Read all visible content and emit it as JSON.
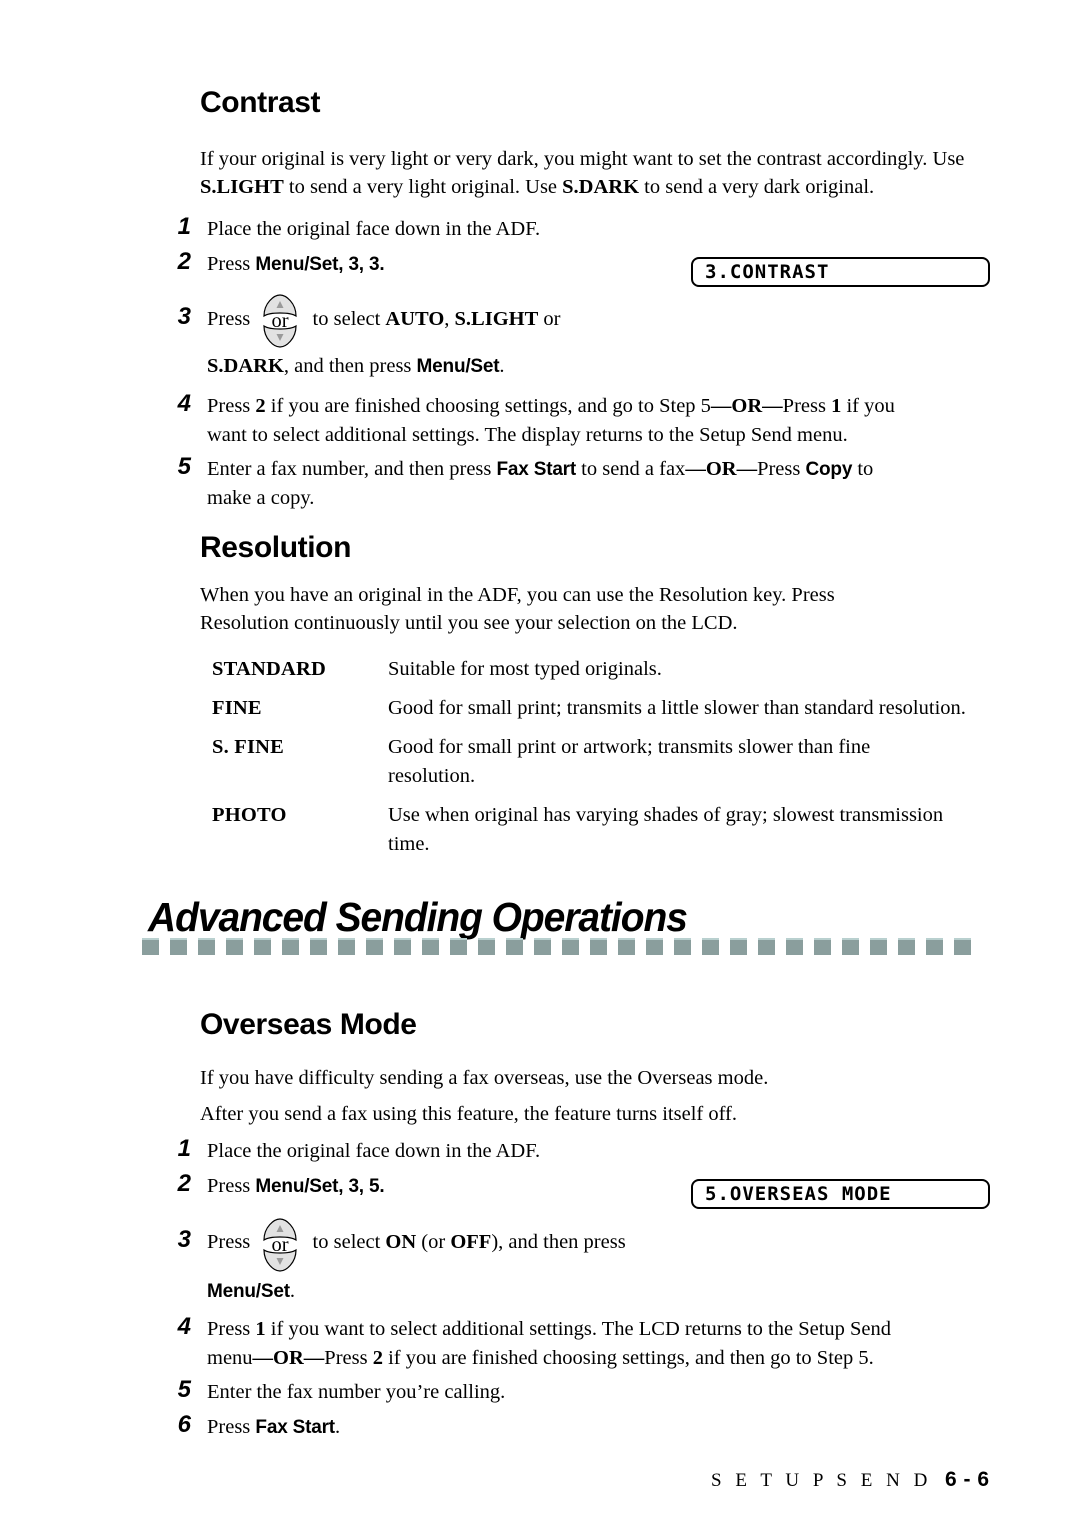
{
  "document": {
    "footer_label": "S E T U P   S E N D",
    "footer_page": "6 - 6"
  },
  "contrast": {
    "heading": "Contrast",
    "intro_line1": "If your original is very light or very dark, you might want to set the contrast accordingly.",
    "intro_line2_a": "Use ",
    "intro_line2_b": "S.LIGHT",
    "intro_line2_c": " to send a very light original. Use ",
    "intro_line2_d": "S.DARK",
    "intro_line2_e": " to send a very dark original.",
    "steps": [
      {
        "num": "1",
        "text": "Place the original face down in the ADF."
      },
      {
        "num": "2",
        "pre": "Press ",
        "key": "Menu/Set",
        "post": ", 3, 3."
      },
      {
        "num": "3",
        "pre": "Press ",
        "icon": "up-down-arrow-key",
        "icon_or_label": "or",
        "mid": " to select ",
        "opt1": "AUTO",
        "sep1": ", ",
        "opt2": "S.LIGHT",
        "tail": " or",
        "line2_a": "S.DARK",
        "line2_b": ", and then press ",
        "line2_key": "Menu/Set",
        "line2_c": "."
      },
      {
        "num": "4",
        "a": "Press ",
        "b": "2",
        "c": " if you are finished choosing settings, and go to Step 5",
        "d": "—OR—",
        "e": "Press ",
        "f": "1",
        "g": " if you",
        "line2": "want to select additional settings. The display returns to the Setup Send menu."
      },
      {
        "num": "5",
        "a": "Enter a fax number, and then press ",
        "b": "Fax Start",
        "c": " to send a fax",
        "d": "—OR—",
        "e": "Press ",
        "f": "Copy",
        "g": " to",
        "line2": "make a copy."
      }
    ],
    "lcd": "3.CONTRAST"
  },
  "resolution": {
    "heading": "Resolution",
    "intro_a": "When you have an original in the ADF, you can use the ",
    "intro_b": "Resolution",
    "intro_c": " key. Press",
    "intro_d": "Resolution",
    "intro_e": " continuously until you see your selection on the LCD.",
    "modes": [
      {
        "term": "STANDARD",
        "desc": "Suitable for most typed originals."
      },
      {
        "term": "FINE",
        "desc": "Good for small print; transmits a little slower than standard resolution."
      },
      {
        "term": "S. FINE",
        "desc": "Good for small print or artwork; transmits slower than fine resolution."
      },
      {
        "term": "PHOTO",
        "desc": "Use when original has varying shades of gray; slowest transmission time."
      }
    ]
  },
  "banner": {
    "title": "Advanced Sending Operations",
    "rule_color": "#8a9e9d",
    "rule_segments": 30
  },
  "overseas": {
    "heading": "Overseas Mode",
    "intro_line1": "If you have difficulty sending a fax overseas, use the Overseas mode.",
    "intro_line2": "After you send a fax using this feature, the feature turns itself off.",
    "steps": [
      {
        "num": "1",
        "text": "Place the original face down in the ADF."
      },
      {
        "num": "2",
        "pre": "Press ",
        "key": "Menu/Set",
        "post": ", 3, 5."
      },
      {
        "num": "3",
        "pre": "Press ",
        "icon": "up-down-arrow-key",
        "icon_or_label": "or",
        "mid": " to select ",
        "opt1": "ON",
        "sep1": " (or ",
        "opt2": "OFF",
        "tail": "), and then press",
        "line2_key": "Menu/Set",
        "line2_c": "."
      },
      {
        "num": "4",
        "a": "Press ",
        "b": "1",
        "c": " if you want to select additional settings. The LCD returns to the Setup Send",
        "line2_a": "menu",
        "line2_b": "—OR—",
        "line2_c": "Press ",
        "line2_d": "2",
        "line2_e": " if you are finished choosing settings, and then go to Step 5."
      },
      {
        "num": "5",
        "text": "Enter the fax number you’re calling."
      },
      {
        "num": "6",
        "pre": "Press ",
        "key": "Fax Start",
        "post": "."
      }
    ],
    "lcd": "5.OVERSEAS MODE"
  }
}
